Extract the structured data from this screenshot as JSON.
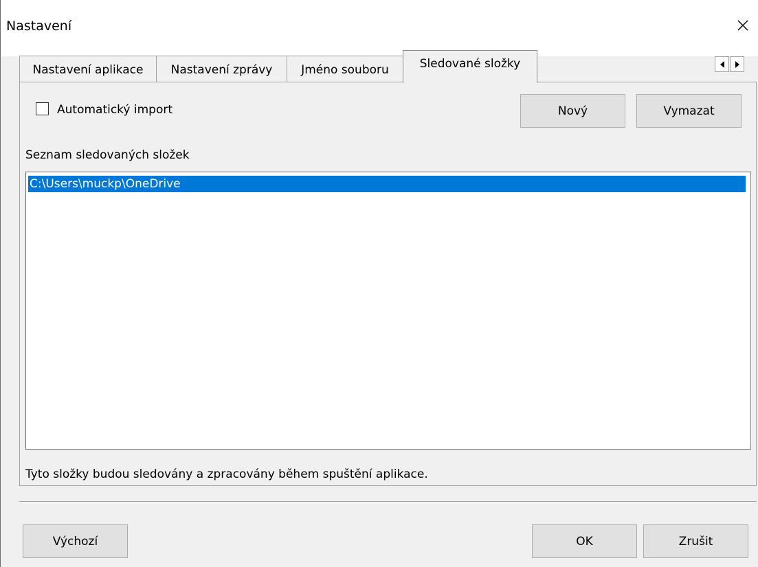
{
  "window": {
    "title": "Nastavení",
    "close_icon": "close-icon"
  },
  "tabs": [
    {
      "label": "Nastavení aplikace",
      "selected": false
    },
    {
      "label": "Nastavení zprávy",
      "selected": false
    },
    {
      "label": "Jméno souboru",
      "selected": false
    },
    {
      "label": "Sledované složky",
      "selected": true
    }
  ],
  "tab_scroll": {
    "left_icon": "triangle-left-icon",
    "right_icon": "triangle-right-icon"
  },
  "auto_import": {
    "label": "Automatický import",
    "checked": false
  },
  "buttons": {
    "new": "Nový",
    "delete": "Vymazat",
    "default": "Výchozí",
    "ok": "OK",
    "cancel": "Zrušit"
  },
  "folder_list": {
    "caption": "Seznam sledovaných složek",
    "items": [
      "C:\\Users\\muckp\\OneDrive"
    ],
    "selected_index": 0,
    "selection_color": "#0078d7"
  },
  "info_text": "Tyto složky budou sledovány a zpracovány během spuštění aplikace."
}
